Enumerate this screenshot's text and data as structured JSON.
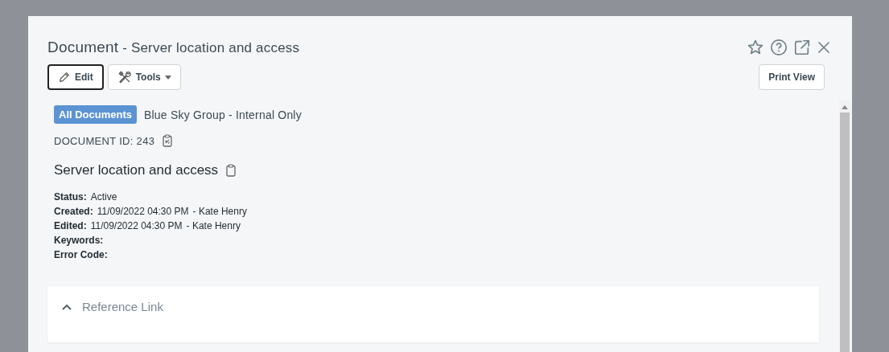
{
  "dialog": {
    "title": "Document",
    "subtitle": "- Server location and access"
  },
  "toolbar": {
    "edit": "Edit",
    "tools": "Tools",
    "print_view": "Print View"
  },
  "document": {
    "category_badge": "All Documents",
    "group": "Blue Sky Group - Internal Only",
    "document_id": "DOCUMENT ID: 243",
    "heading": "Server location and access",
    "fields": [
      {
        "label": "Status:",
        "value": "Active"
      },
      {
        "label": "Created:",
        "value": "11/09/2022 04:30 PM",
        "author": "- Kate Henry"
      },
      {
        "label": "Edited:",
        "value": "11/09/2022 04:30 PM",
        "author": "- Kate Henry"
      },
      {
        "label": "Keywords:"
      },
      {
        "label": "Error Code:"
      }
    ]
  },
  "sections": [
    {
      "title": "Reference Link",
      "expanded": true
    }
  ]
}
